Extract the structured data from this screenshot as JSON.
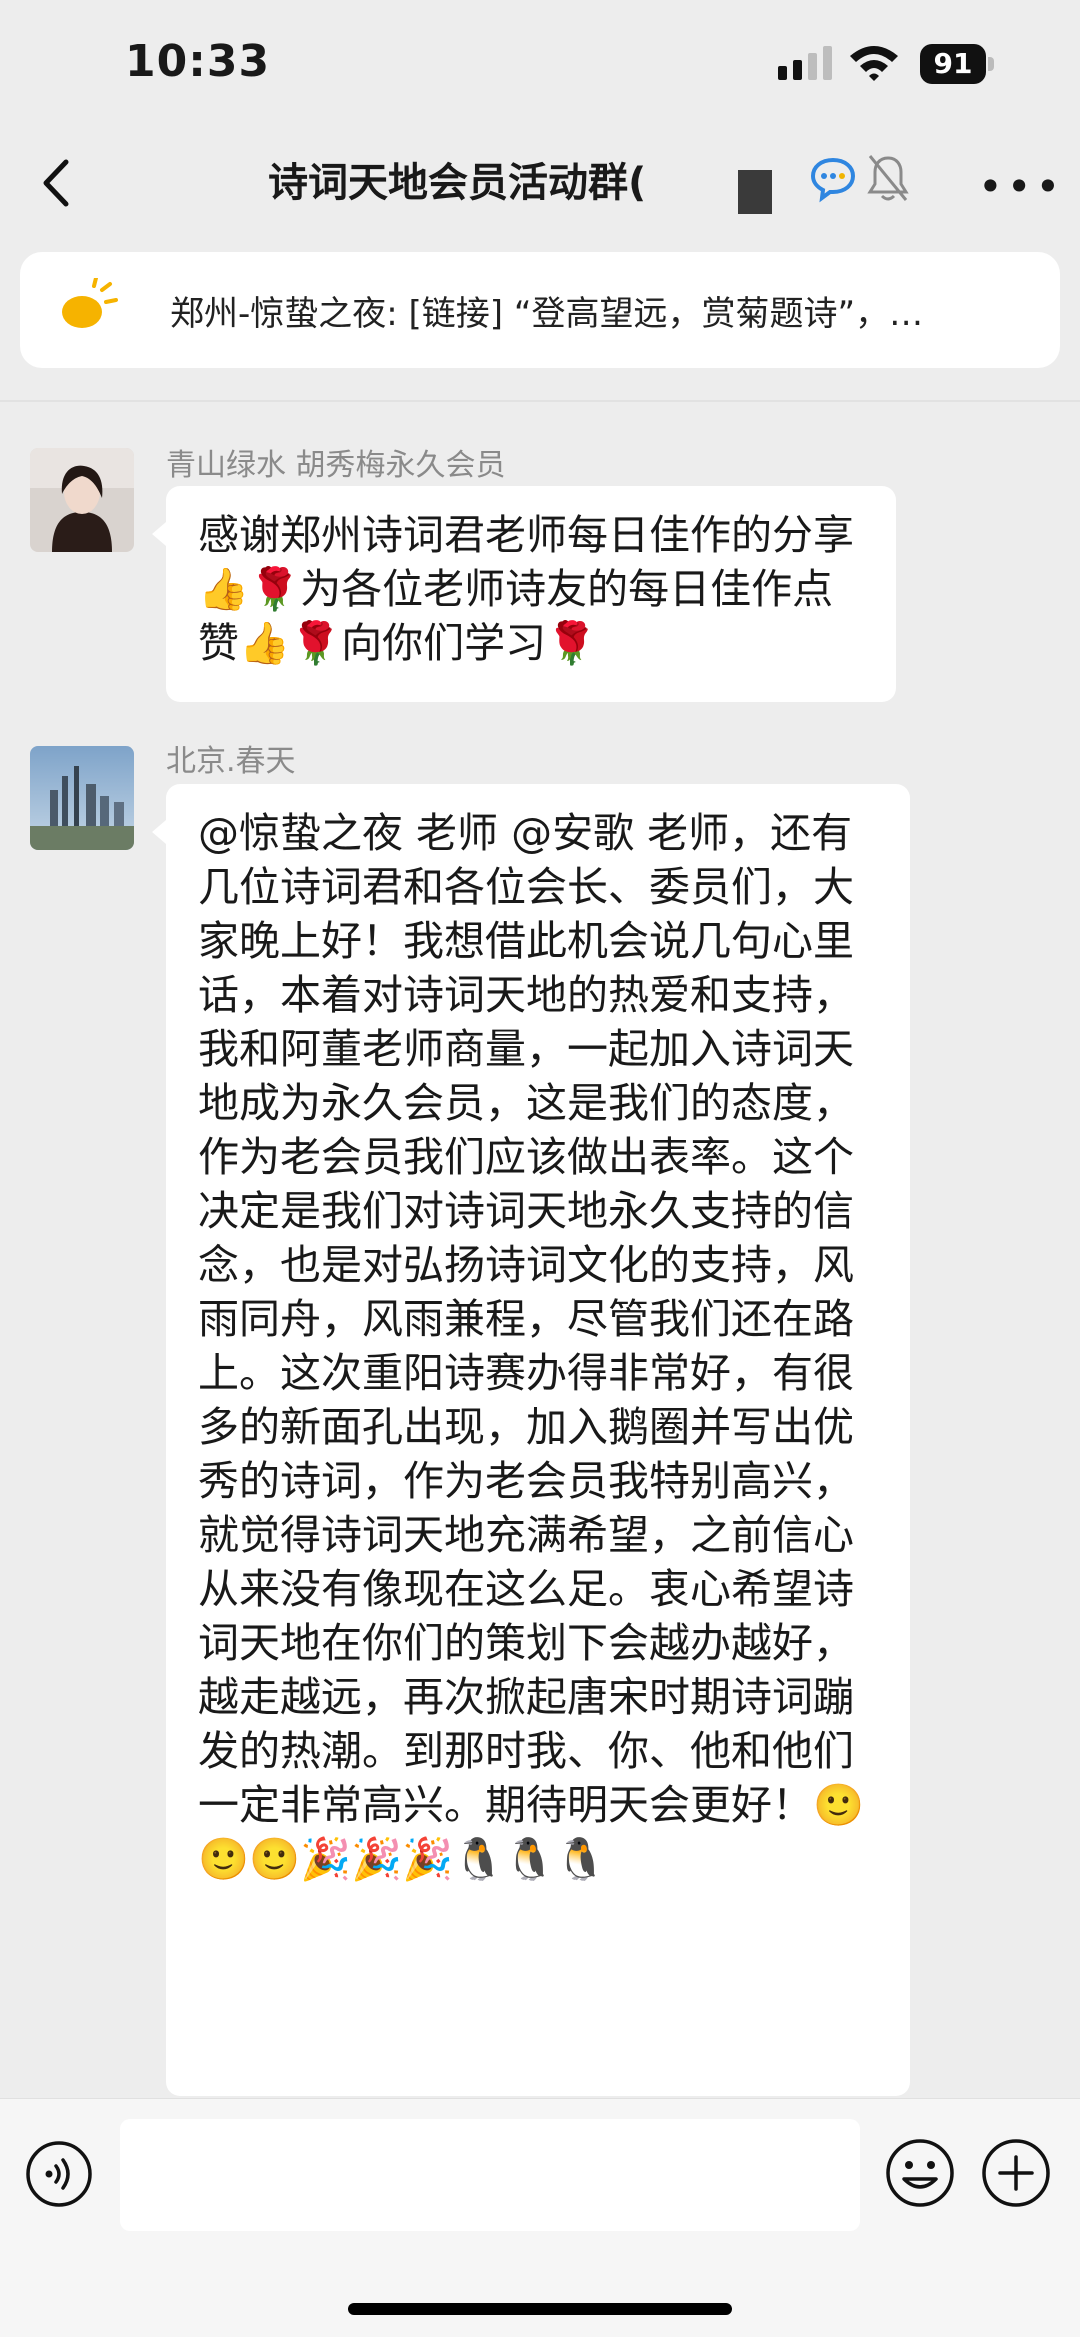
{
  "status_bar": {
    "time": "10:33",
    "battery": "91"
  },
  "nav": {
    "title": "诗词天地会员活动群(",
    "icons": [
      "back-icon",
      "chat-bubble-icon",
      "mute-bell-icon",
      "more-icon"
    ]
  },
  "notice": {
    "text": "郑州-惊蛰之夜: [链接] “登高望远，赏菊题诗”，…"
  },
  "messages": [
    {
      "sender": "青山绿水 胡秀梅永久会员",
      "text": "感谢郑州诗词君老师每日佳作的分享👍🌹为各位老师诗友的每日佳作点赞👍🌹向你们学习🌹"
    },
    {
      "sender": "北京.春天",
      "text": "@惊蛰之夜 老师 @安歌 老师，还有几位诗词君和各位会长、委员们，大家晚上好！我想借此机会说几句心里话，本着对诗词天地的热爱和支持，我和阿董老师商量，一起加入诗词天地成为永久会员，这是我们的态度，作为老会员我们应该做出表率。这个决定是我们对诗词天地永久支持的信念，也是对弘扬诗词文化的支持，风雨同舟，风雨兼程，尽管我们还在路上。这次重阳诗赛办得非常好，有很多的新面孔出现，加入鹅圈并写出优秀的诗词，作为老会员我特别高兴，就觉得诗词天地充满希望，之前信心从来没有像现在这么足。衷心希望诗词天地在你们的策划下会越办越好，越走越远，再次掀起唐宋时期诗词蹦发的热潮。到那时我、你、他和他们一定非常高兴。期待明天会更好！🙂🙂🙂🎉🎉🎉🐧🐧🐧"
    }
  ],
  "input_bar": {
    "placeholder": "",
    "icons": [
      "voice-icon",
      "emoji-icon",
      "plus-icon"
    ]
  },
  "colors": {
    "background": "#ededed",
    "bubble": "#ffffff",
    "sender": "#8a8a8a"
  }
}
